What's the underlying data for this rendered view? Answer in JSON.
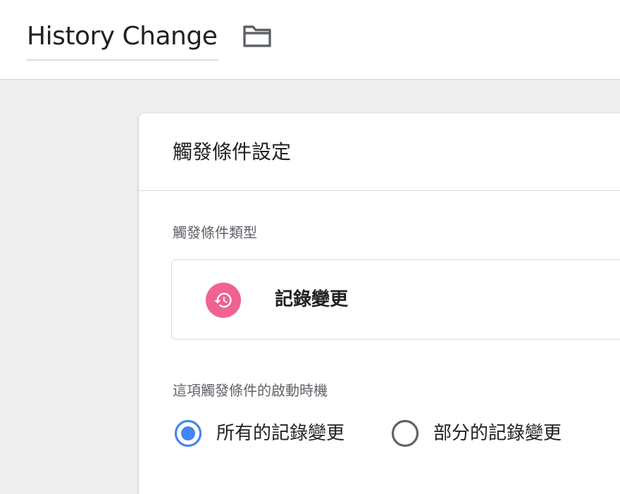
{
  "header": {
    "title": "History Change",
    "folder_icon": "folder-icon"
  },
  "panel": {
    "title": "觸發條件設定",
    "trigger_type_label": "觸發條件類型",
    "trigger_type": {
      "icon": "history-icon",
      "icon_color": "#f06292",
      "name": "記錄變更"
    },
    "fire_on_label": "這項觸發條件的啟動時機",
    "fire_on_options": [
      {
        "label": "所有的記錄變更",
        "selected": true
      },
      {
        "label": "部分的記錄變更",
        "selected": false
      }
    ]
  },
  "colors": {
    "accent": "#4285f4",
    "radio_unselected": "#5f6368"
  }
}
